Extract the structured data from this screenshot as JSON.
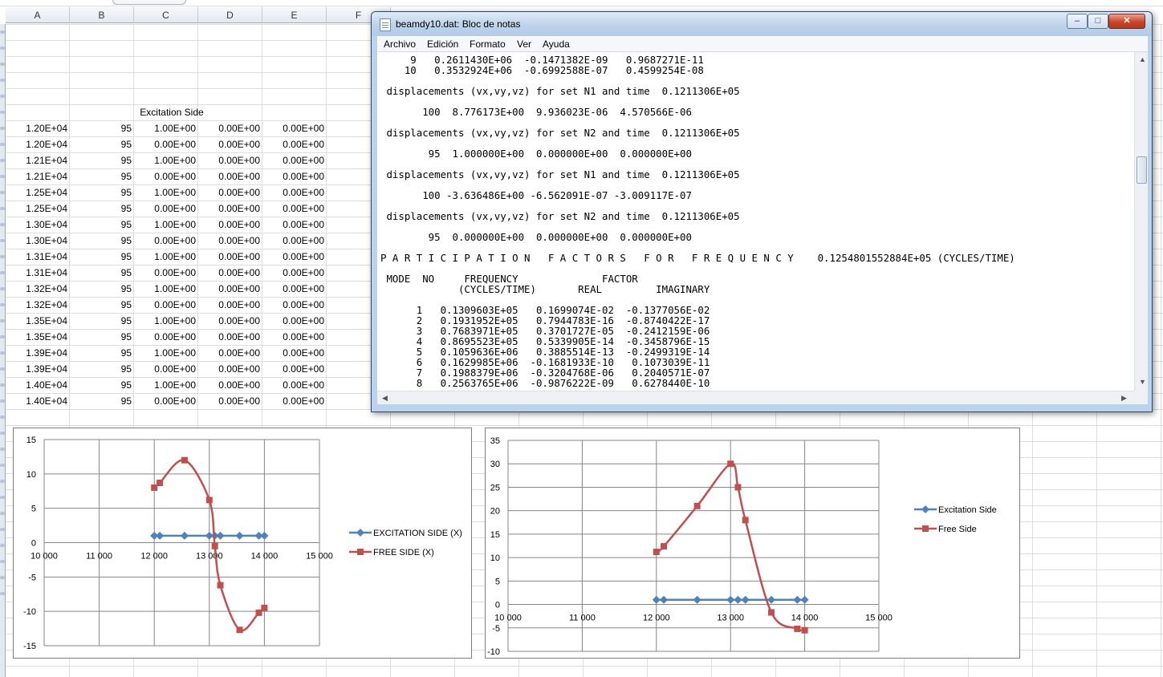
{
  "spreadsheet": {
    "columns": [
      "A",
      "B",
      "C",
      "D",
      "E",
      "F"
    ],
    "header_label": "Excitation Side",
    "rows": [
      [
        "1.20E+04",
        "95",
        "1.00E+00",
        "0.00E+00",
        "0.00E+00"
      ],
      [
        "1.20E+04",
        "95",
        "0.00E+00",
        "0.00E+00",
        "0.00E+00"
      ],
      [
        "1.21E+04",
        "95",
        "1.00E+00",
        "0.00E+00",
        "0.00E+00"
      ],
      [
        "1.21E+04",
        "95",
        "0.00E+00",
        "0.00E+00",
        "0.00E+00"
      ],
      [
        "1.25E+04",
        "95",
        "1.00E+00",
        "0.00E+00",
        "0.00E+00"
      ],
      [
        "1.25E+04",
        "95",
        "0.00E+00",
        "0.00E+00",
        "0.00E+00"
      ],
      [
        "1.30E+04",
        "95",
        "1.00E+00",
        "0.00E+00",
        "0.00E+00"
      ],
      [
        "1.30E+04",
        "95",
        "0.00E+00",
        "0.00E+00",
        "0.00E+00"
      ],
      [
        "1.31E+04",
        "95",
        "1.00E+00",
        "0.00E+00",
        "0.00E+00"
      ],
      [
        "1.31E+04",
        "95",
        "0.00E+00",
        "0.00E+00",
        "0.00E+00"
      ],
      [
        "1.32E+04",
        "95",
        "1.00E+00",
        "0.00E+00",
        "0.00E+00"
      ],
      [
        "1.32E+04",
        "95",
        "0.00E+00",
        "0.00E+00",
        "0.00E+00"
      ],
      [
        "1.35E+04",
        "95",
        "1.00E+00",
        "0.00E+00",
        "0.00E+00"
      ],
      [
        "1.35E+04",
        "95",
        "0.00E+00",
        "0.00E+00",
        "0.00E+00"
      ],
      [
        "1.39E+04",
        "95",
        "1.00E+00",
        "0.00E+00",
        "0.00E+00"
      ],
      [
        "1.39E+04",
        "95",
        "0.00E+00",
        "0.00E+00",
        "0.00E+00"
      ],
      [
        "1.40E+04",
        "95",
        "1.00E+00",
        "0.00E+00",
        "0.00E+00"
      ],
      [
        "1.40E+04",
        "95",
        "0.00E+00",
        "0.00E+00",
        "0.00E+00"
      ]
    ]
  },
  "notepad": {
    "title": "beamdy10.dat: Bloc de notas",
    "controls": {
      "minimize": "–",
      "maximize": "□",
      "close": "✕"
    },
    "menu": [
      "Archivo",
      "Edición",
      "Formato",
      "Ver",
      "Ayuda"
    ],
    "lines": [
      "     9   0.2611430E+06  -0.1471382E-09   0.9687271E-11",
      "    10   0.3532924E+06  -0.6992588E-07   0.4599254E-08",
      "",
      " displacements (vx,vy,vz) for set N1 and time  0.1211306E+05",
      "",
      "       100  8.776173E+00  9.936023E-06  4.570566E-06",
      "",
      " displacements (vx,vy,vz) for set N2 and time  0.1211306E+05",
      "",
      "        95  1.000000E+00  0.000000E+00  0.000000E+00",
      "",
      " displacements (vx,vy,vz) for set N1 and time  0.1211306E+05",
      "",
      "       100 -3.636486E+00 -6.562091E-07 -3.009117E-07",
      "",
      " displacements (vx,vy,vz) for set N2 and time  0.1211306E+05",
      "",
      "        95  0.000000E+00  0.000000E+00  0.000000E+00",
      "",
      "P A R T I C I P A T I O N   F A C T O R S   F O R   F R E Q U E N C Y    0.1254801552884E+05 (CYCLES/TIME)",
      "",
      " MODE  NO     FREQUENCY              FACTOR",
      "             (CYCLES/TIME)       REAL         IMAGINARY",
      "",
      "      1   0.1309603E+05   0.1699074E-02  -0.1377056E-02",
      "      2   0.1931952E+05   0.7944783E-16  -0.8740422E-17",
      "      3   0.7683971E+05   0.3701727E-05  -0.2412159E-06",
      "      4   0.8695523E+05   0.5339905E-14  -0.3458796E-15",
      "      5   0.1059636E+06   0.3885514E-13  -0.2499319E-14",
      "      6   0.1629985E+06  -0.1681933E-10   0.1073039E-11",
      "      7   0.1988379E+06  -0.3204768E-06   0.2040571E-07",
      "      8   0.2563765E+06  -0.9876222E-09   0.6278440E-10"
    ]
  },
  "chart_data": [
    {
      "type": "scatter",
      "xlim": [
        10000,
        15000
      ],
      "ylim": [
        -15,
        15
      ],
      "x_ticks": [
        "10 000",
        "11 000",
        "12 000",
        "13 000",
        "14 000",
        "15 000"
      ],
      "y_ticks": [
        "15",
        "10",
        "5",
        "0",
        "-5",
        "-10",
        "-15"
      ],
      "grid": true,
      "legend_position": "right",
      "series": [
        {
          "name": "EXCITATION SIDE (X)",
          "color": "#4f81bd",
          "marker": "diamond",
          "x": [
            12000,
            12100,
            12550,
            13000,
            13100,
            13200,
            13550,
            13900,
            14000
          ],
          "y": [
            1,
            1,
            1,
            1,
            1,
            1,
            1,
            1,
            1
          ]
        },
        {
          "name": "FREE SIDE (X)",
          "color": "#c0504d",
          "marker": "square",
          "x": [
            12000,
            12100,
            12550,
            13000,
            13100,
            13200,
            13550,
            13900,
            14000
          ],
          "y": [
            8,
            8.7,
            12,
            6.2,
            -0.5,
            -6.2,
            -12.7,
            -10.2,
            -9.5
          ]
        }
      ]
    },
    {
      "type": "scatter",
      "xlim": [
        10000,
        15000
      ],
      "ylim": [
        -10,
        35
      ],
      "x_ticks": [
        "10 000",
        "11 000",
        "12 000",
        "13 000",
        "14 000",
        "15 000"
      ],
      "y_ticks": [
        "35",
        "30",
        "25",
        "20",
        "15",
        "10",
        "5",
        "0",
        "-5",
        "-10"
      ],
      "grid": true,
      "legend_position": "right",
      "series": [
        {
          "name": "Excitation Side",
          "color": "#4f81bd",
          "marker": "diamond",
          "x": [
            12000,
            12100,
            12550,
            13000,
            13100,
            13200,
            13550,
            13900,
            14000
          ],
          "y": [
            1,
            1,
            1,
            1,
            1,
            1,
            1,
            1,
            1
          ]
        },
        {
          "name": "Free Side",
          "color": "#c0504d",
          "marker": "square",
          "x": [
            12000,
            12100,
            12550,
            13000,
            13100,
            13200,
            13550,
            13900,
            14000
          ],
          "y": [
            11.2,
            12.4,
            21,
            30,
            25,
            18,
            -1.7,
            -5.2,
            -5.5
          ]
        }
      ]
    }
  ]
}
